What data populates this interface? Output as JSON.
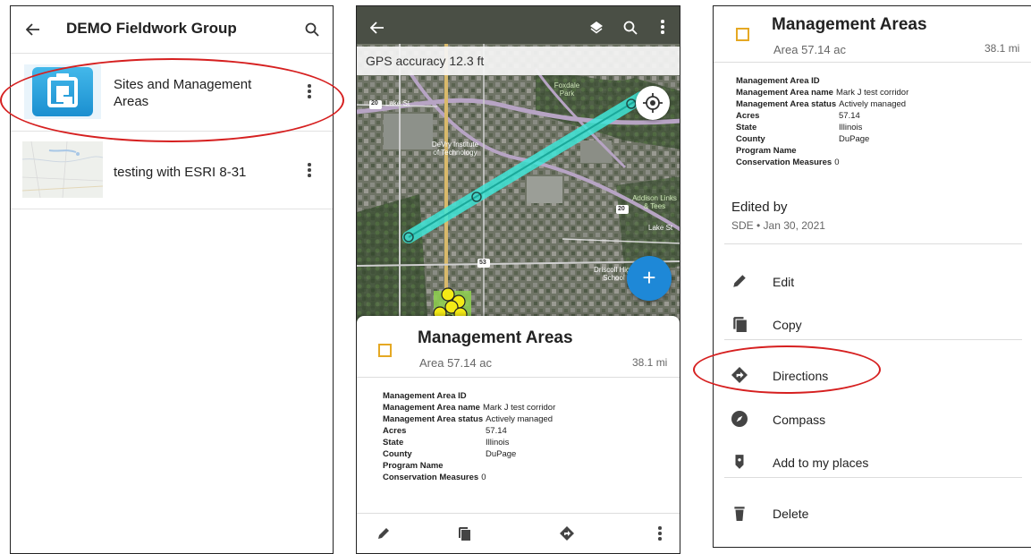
{
  "screen1": {
    "title": "DEMO Fieldwork Group",
    "items": [
      {
        "label": "Sites and Management Areas"
      },
      {
        "label": "testing with ESRI 8-31"
      }
    ]
  },
  "screen2": {
    "gps_text": "GPS accuracy 12.3 ft",
    "fab_label": "+",
    "map_labels": {
      "foxdale": "Foxdale Park",
      "lake_st": "Lake St",
      "devry": "DeVry Institute of Technology",
      "addison": "Addison Links & Tees",
      "driscoll": "Driscoll High School",
      "route20a": "20",
      "route20b": "20",
      "route53": "53",
      "lake_st2": "Lake St"
    },
    "feature": {
      "title": "Management Areas",
      "subtitle": "Area 57.14 ac",
      "distance": "38.1 mi"
    }
  },
  "screen3": {
    "feature": {
      "title": "Management Areas",
      "subtitle": "Area 57.14 ac",
      "distance": "38.1 mi"
    },
    "edited_by_label": "Edited by",
    "edited_by_value": "SDE • Jan 30, 2021",
    "menu": [
      {
        "label": "Edit",
        "icon": "pencil-icon"
      },
      {
        "label": "Copy",
        "icon": "copy-icon"
      },
      {
        "label": "Directions",
        "icon": "directions-icon"
      },
      {
        "label": "Compass",
        "icon": "compass-icon"
      },
      {
        "label": "Add to my places",
        "icon": "bookmark-icon"
      },
      {
        "label": "Delete",
        "icon": "trash-icon"
      }
    ]
  },
  "attributes": [
    {
      "key": "Management Area ID",
      "value": ""
    },
    {
      "key": "Management Area name",
      "value": "Mark J test corridor"
    },
    {
      "key": "Management Area status",
      "value": "Actively managed"
    },
    {
      "key": "Acres",
      "value": "57.14"
    },
    {
      "key": "State",
      "value": "Illinois"
    },
    {
      "key": "County",
      "value": "DuPage"
    },
    {
      "key": "Program Name",
      "value": ""
    },
    {
      "key": "Conservation Measures",
      "value": "0"
    }
  ],
  "colors": {
    "annotation_red": "#d62020",
    "fab_blue": "#1e88d7",
    "feature_outline": "#e5a823",
    "corridor_cyan": "#3fe6d8"
  }
}
